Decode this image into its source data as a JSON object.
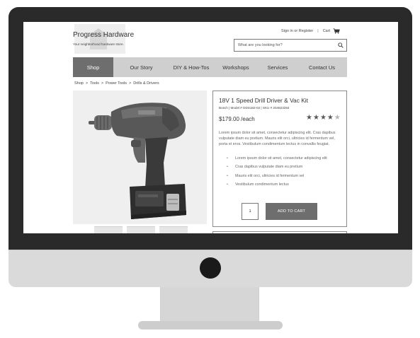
{
  "header": {
    "brand_name": "Progress Hardware",
    "tagline": "Your neighborhood hardware store.",
    "signin_label": "Sign in or Register",
    "separator": "|",
    "cart_label": "Cart",
    "cart_icon": "cart-icon",
    "logo_icon": "store-logo-icon"
  },
  "search": {
    "placeholder": "What are you looking for?",
    "value": "",
    "icon": "search-icon"
  },
  "nav": {
    "items": [
      {
        "label": "Shop",
        "active": true
      },
      {
        "label": "Our Story",
        "active": false
      },
      {
        "label": "DIY & How-Tos",
        "active": false
      },
      {
        "label": "Workshops",
        "active": false
      },
      {
        "label": "Services",
        "active": false
      },
      {
        "label": "Contact Us",
        "active": false
      }
    ]
  },
  "breadcrumb": {
    "separator": ">",
    "items": [
      "Shop",
      "Tools",
      "Power Tools",
      "Drills & Drivers"
    ]
  },
  "product": {
    "title": "18V 1 Speed Drill Driver & Vac Kit",
    "meta": "Bosch | Model # DDS182-02 | SKU # 204823284",
    "rating": 4,
    "rating_max": 5,
    "price": "$179.00 /each",
    "description": "Lorem ipsum dolor sit amet, consectetur adipiscing elit. Cras dapibus vulputate diam eu pretium. Mauris elit orci, ultricies id fermentum vel, porta et eros. Vestibulum condimentum lectus in convallis feugiat.",
    "bullets": [
      "Lorem ipsum dolor sit amet, consectetur adipiscing elit",
      "Cras dapibus vulputate diam eu pretium",
      "Mauris elit orci, ultricies id fermentum vel",
      "Vestibulum condimentum lectus"
    ],
    "quantity": "1",
    "add_to_cart_label": "ADD TO CART",
    "image_icon": "cordless-drill-icon"
  },
  "colors": {
    "nav_active": "#6e6e6e",
    "nav_bg": "#cfcfcf",
    "button": "#6e6e6e",
    "monitor_bezel": "#2a2a2a",
    "monitor_chin": "#dadada"
  }
}
